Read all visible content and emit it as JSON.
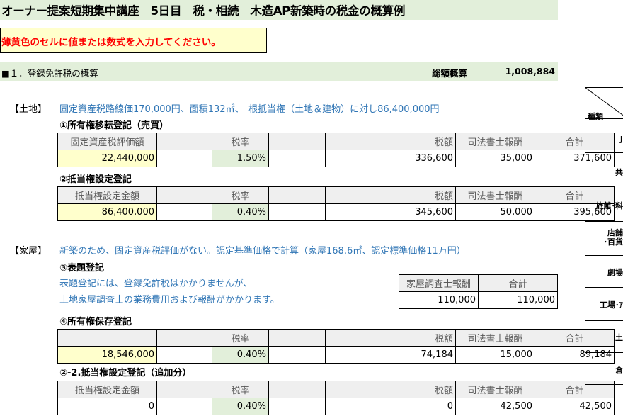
{
  "title": "オーナー提案短期集中講座　5日目　税・相続　木造AP新築時の税金の概算例",
  "notice": "薄黄色のセルに値または数式を入力してください。",
  "section1": {
    "heading": "■１．登録免許税の概算",
    "total_label": "総額概算",
    "total_value": "1,008,884"
  },
  "land": {
    "tag": "【土地】",
    "desc": "固定資産税路線価170,000円、面積132㎡、　根抵当権（土地＆建物）に対し86,400,000円",
    "reg1": {
      "title": "①所有権移転登記（売買）",
      "headers": [
        "固定資産税評価額",
        "",
        "税率",
        "",
        "税額",
        "司法書士報酬",
        "合計"
      ],
      "row": [
        "22,440,000",
        "",
        "1.50%",
        "",
        "336,600",
        "35,000",
        "371,600"
      ]
    },
    "reg2": {
      "title": "②抵当権設定登記",
      "headers": [
        "抵当権設定金額",
        "",
        "税率",
        "",
        "税額",
        "司法書士報酬",
        "合計"
      ],
      "row": [
        "86,400,000",
        "",
        "0.40%",
        "",
        "345,600",
        "50,000",
        "395,600"
      ]
    }
  },
  "house": {
    "tag": "【家屋】",
    "desc": "新築のため、固定資産税評価がない。認定基準価格で計算（家屋168.6㎡、認定標準価格11万円）",
    "reg3": {
      "title": "③表題登記",
      "note1": "表題登記には、登録免許税はかかりませんが、",
      "note2": "土地家屋調査士の業務費用および報酬がかかります。",
      "headers": [
        "家屋調査士報酬",
        "合計"
      ],
      "row": [
        "110,000",
        "110,000"
      ]
    },
    "reg4": {
      "title": "④所有権保存登記",
      "headers": [
        "",
        "",
        "税率",
        "",
        "税額",
        "司法書士報酬",
        "合計"
      ],
      "row": [
        "18,546,000",
        "",
        "0.40%",
        "",
        "74,184",
        "15,000",
        "89,184"
      ]
    },
    "reg5": {
      "title": "②-2.抵当権設定登記（追加分）",
      "headers": [
        "抵当権設定金額",
        "",
        "税率",
        "",
        "税額",
        "司法書士報酬",
        "合計"
      ],
      "row": [
        "0",
        "",
        "0.40%",
        "",
        "0",
        "42,500",
        "42,500"
      ]
    }
  },
  "right_table": {
    "header": "種類",
    "rows": [
      "J",
      "共",
      "旅館･料",
      "店舗\n･百貨",
      "劇場",
      "工場･ｱ",
      "土",
      "倉"
    ]
  }
}
